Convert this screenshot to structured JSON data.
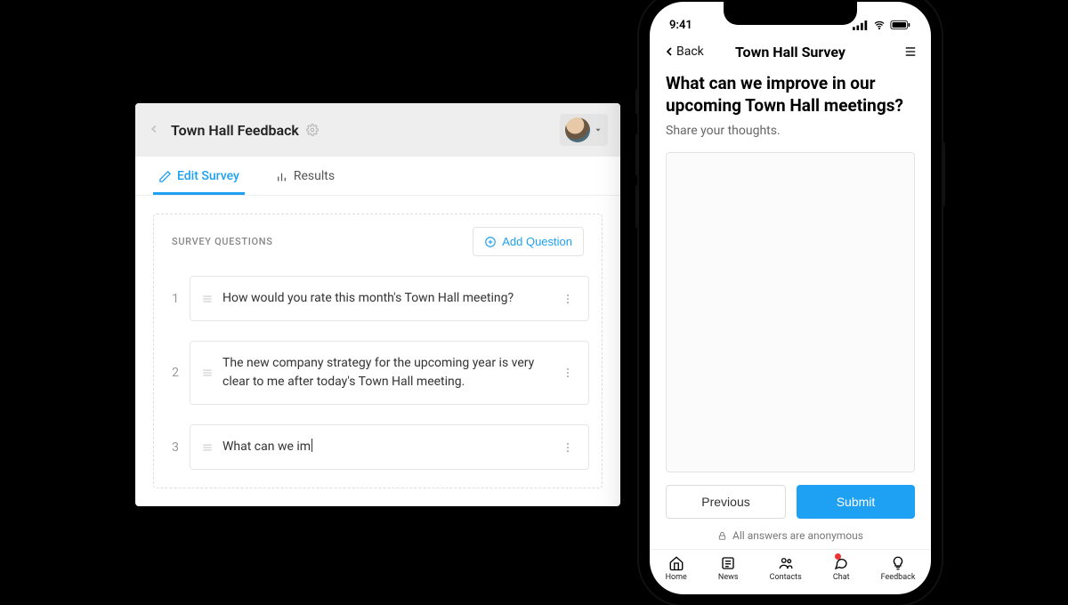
{
  "editor": {
    "title": "Town Hall Feedback",
    "tabs": {
      "edit": "Edit Survey",
      "results": "Results"
    },
    "sectionTitle": "SURVEY QUESTIONS",
    "addQuestion": "Add Question",
    "questions": [
      {
        "num": "1",
        "text": "How would you rate this month's Town Hall meeting?"
      },
      {
        "num": "2",
        "text": "The new company strategy for the upcoming year is very clear to me after today's Town Hall meeting."
      },
      {
        "num": "3",
        "text": "What can we im"
      }
    ]
  },
  "phone": {
    "statusTime": "9:41",
    "back": "Back",
    "title": "Town Hall Survey",
    "question": "What can we improve in our upcoming Town Hall meetings?",
    "hint": "Share your thoughts.",
    "prev": "Previous",
    "submit": "Submit",
    "anon": "All answers are anonymous",
    "tabs": {
      "home": "Home",
      "news": "News",
      "contacts": "Contacts",
      "chat": "Chat",
      "feedback": "Feedback"
    }
  }
}
